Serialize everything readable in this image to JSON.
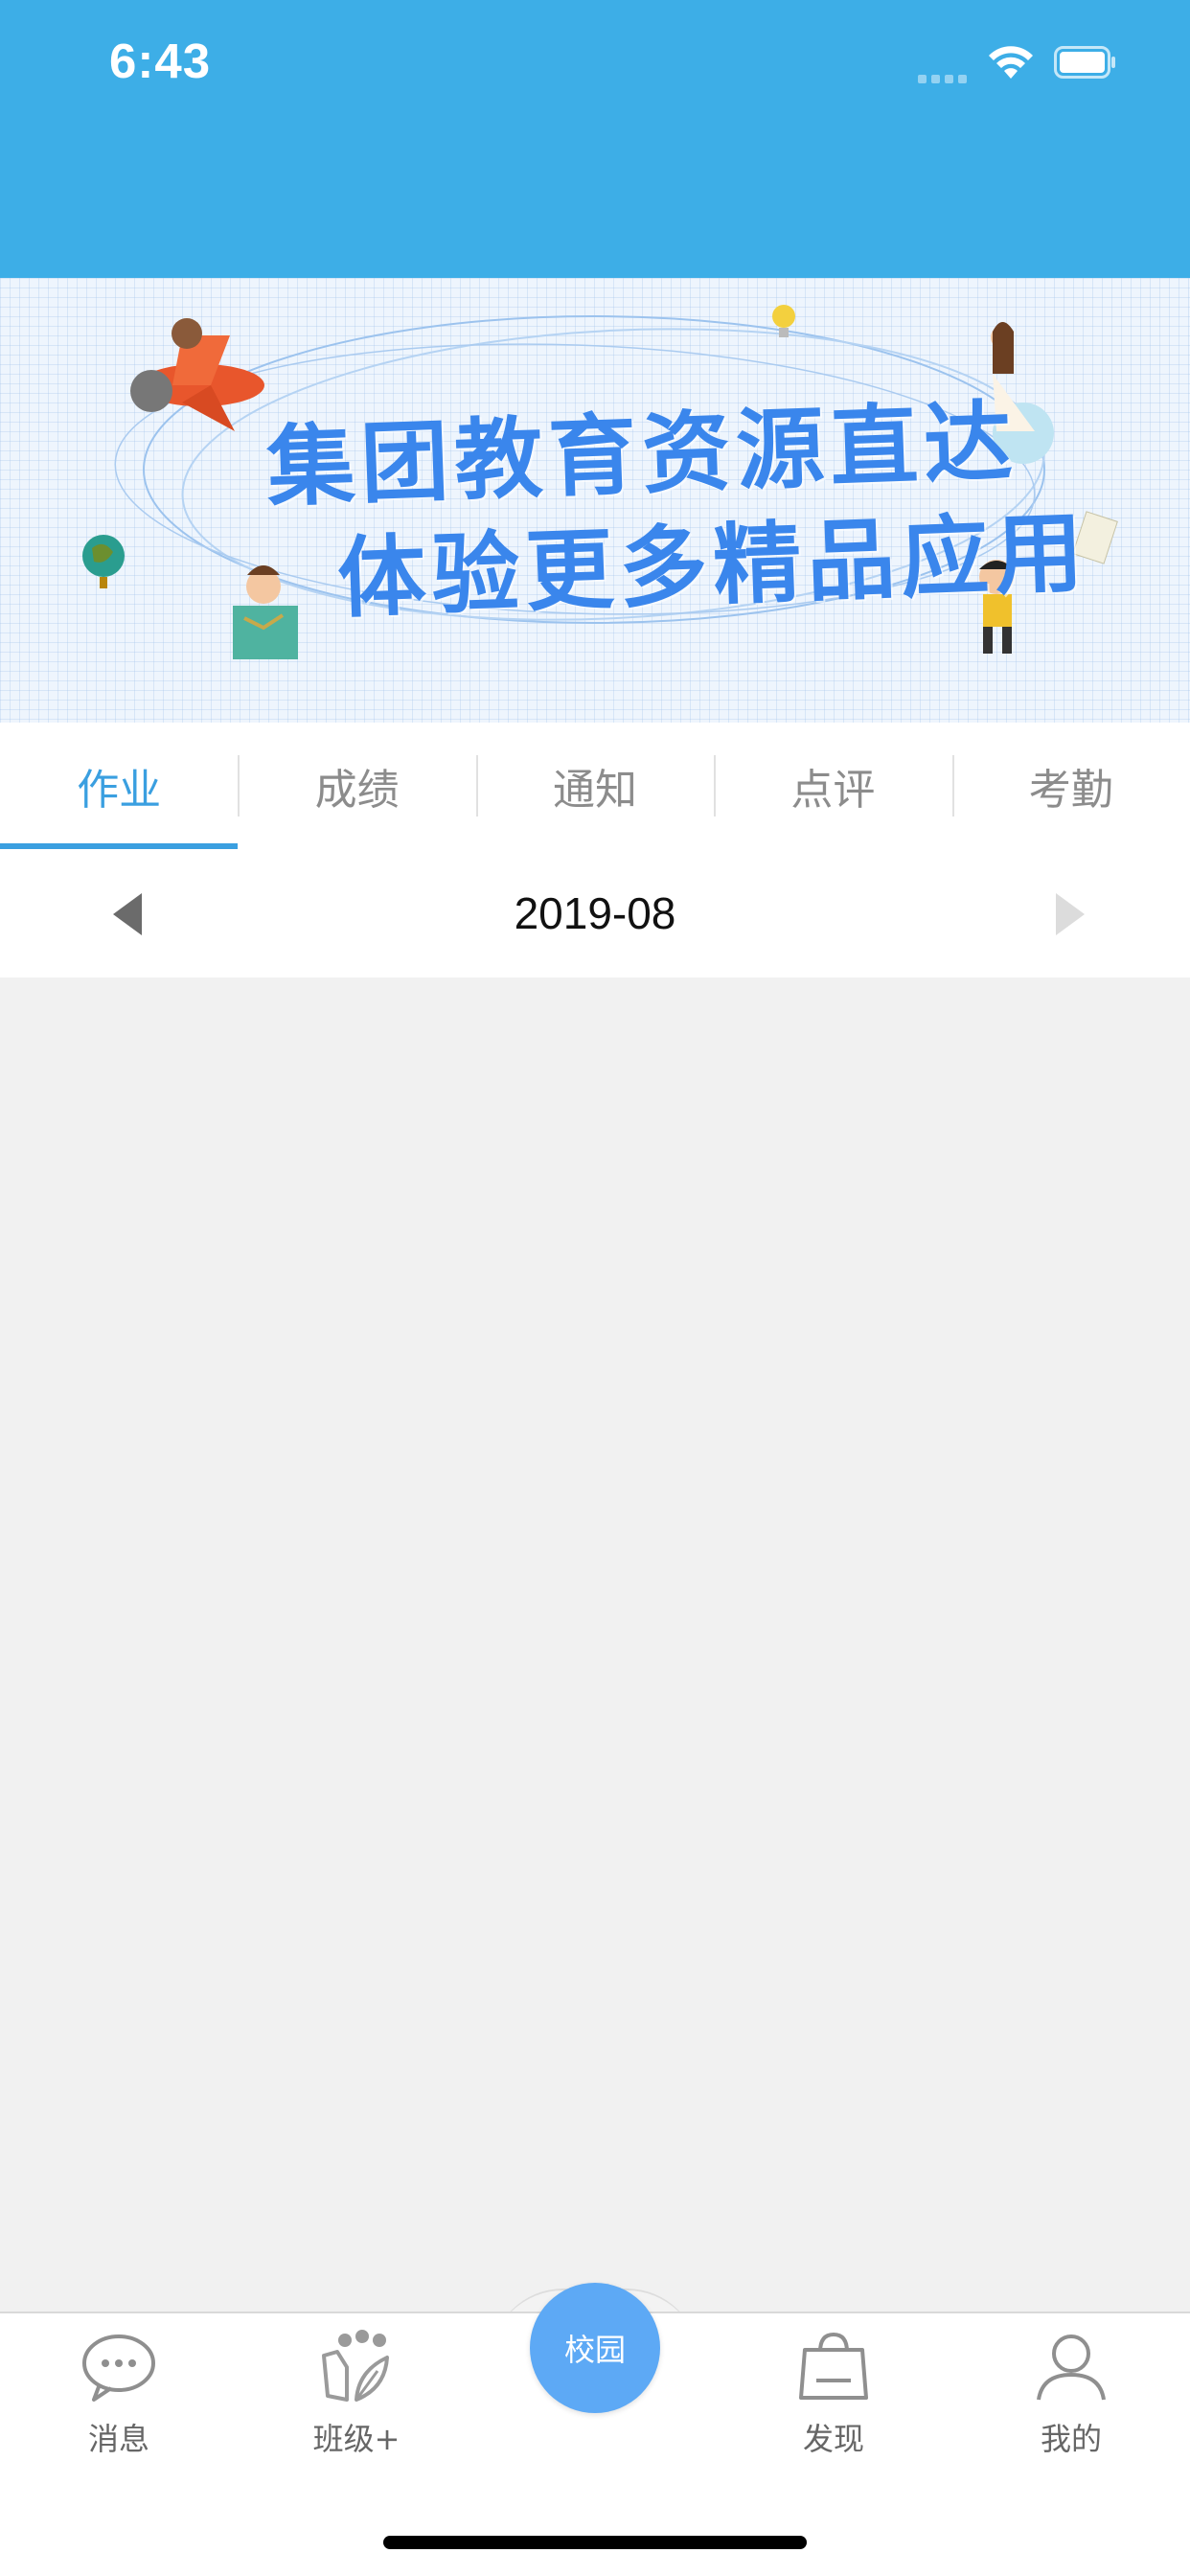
{
  "status_bar": {
    "time": "6:43"
  },
  "banner": {
    "line1": "集团教育资源直达",
    "line2": "体验更多精品应用"
  },
  "tabs": [
    {
      "label": "作业",
      "active": true
    },
    {
      "label": "成绩",
      "active": false
    },
    {
      "label": "通知",
      "active": false
    },
    {
      "label": "点评",
      "active": false
    },
    {
      "label": "考勤",
      "active": false
    }
  ],
  "month_selector": {
    "current": "2019-08",
    "prev_icon": "triangle-left-icon",
    "next_icon": "triangle-right-icon"
  },
  "bottom_nav": {
    "items": [
      {
        "label": "消息",
        "icon": "chat-bubble-icon"
      },
      {
        "label": "班级+",
        "icon": "class-group-icon"
      },
      {
        "label": "发现",
        "icon": "shopping-bag-icon"
      },
      {
        "label": "我的",
        "icon": "user-icon"
      }
    ],
    "center_label": "校园"
  },
  "colors": {
    "header_blue": "#3daee7",
    "active_tab": "#3a9fe0",
    "center_button": "#5da9f5",
    "banner_text": "#3a86ec"
  }
}
